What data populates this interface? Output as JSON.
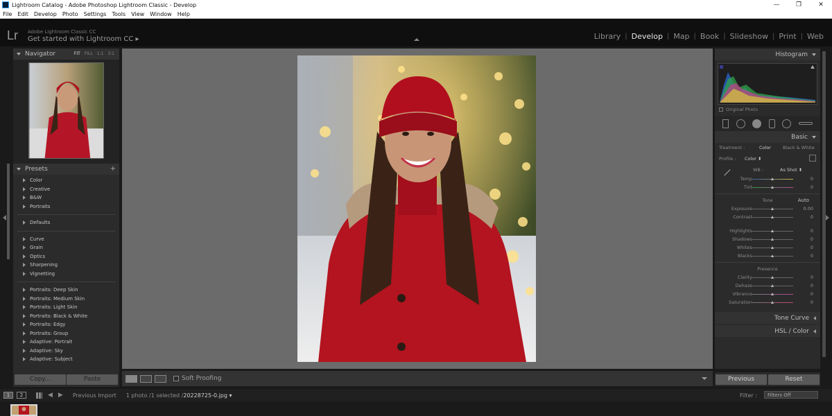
{
  "window": {
    "title": "Lightroom Catalog - Adobe Photoshop Lightroom Classic - Develop",
    "controls": [
      "—",
      "❐",
      "✕"
    ]
  },
  "menu": [
    "File",
    "Edit",
    "Develop",
    "Photo",
    "Settings",
    "Tools",
    "View",
    "Window",
    "Help"
  ],
  "identity": {
    "logo": "Lr",
    "product": "Adobe Lightroom Classic CC",
    "tagline": "Get started with Lightroom CC ▸"
  },
  "modules": {
    "items": [
      "Library",
      "Develop",
      "Map",
      "Book",
      "Slideshow",
      "Print",
      "Web"
    ],
    "active": "Develop"
  },
  "navigator": {
    "title": "Navigator",
    "zoom": [
      "FIT",
      "FILL",
      "1:1",
      "3:1"
    ],
    "zoom_selected": "FIT"
  },
  "presets": {
    "title": "Presets",
    "groups": [
      [
        "Color",
        "Creative",
        "B&W",
        "Portraits"
      ],
      [
        "Defaults"
      ],
      [
        "Curve",
        "Grain",
        "Optics",
        "Sharpening",
        "Vignetting"
      ],
      [
        "Portraits: Deep Skin",
        "Portraits: Medium Skin",
        "Portraits: Light Skin",
        "Portraits: Black & White",
        "Portraits: Edgy",
        "Portraits: Group",
        "Adaptive: Portrait",
        "Adaptive: Sky",
        "Adaptive: Subject"
      ]
    ]
  },
  "left_buttons": {
    "copy": "Copy...",
    "paste": "Paste"
  },
  "toolbar": {
    "soft_proofing": "Soft Proofing"
  },
  "right": {
    "histogram_title": "Histogram",
    "original_photo": "Original Photo",
    "basic_title": "Basic",
    "treatment_label": "Treatment :",
    "treatment_color": "Color",
    "treatment_bw": "Black & White",
    "profile_label": "Profile :",
    "profile_value": "Color ⬍",
    "wb_label": "WB :",
    "wb_value": "As Shot ⬍",
    "wb_sliders": [
      {
        "label": "Temp",
        "value": "0"
      },
      {
        "label": "Tint",
        "value": "0"
      }
    ],
    "tone_label": "Tone",
    "auto_label": "Auto",
    "tone_sliders_a": [
      {
        "label": "Exposure",
        "value": "0.00"
      },
      {
        "label": "Contrast",
        "value": "0"
      }
    ],
    "tone_sliders_b": [
      {
        "label": "Highlights",
        "value": "0"
      },
      {
        "label": "Shadows",
        "value": "0"
      },
      {
        "label": "Whites",
        "value": "0"
      },
      {
        "label": "Blacks",
        "value": "0"
      }
    ],
    "presence_label": "Presence",
    "presence_sliders": [
      {
        "label": "Clarity",
        "value": "0"
      },
      {
        "label": "Dehaze",
        "value": "0"
      },
      {
        "label": "Vibrance",
        "value": "0"
      },
      {
        "label": "Saturation",
        "value": "0"
      }
    ],
    "tone_curve_title": "Tone Curve",
    "hsl_title": "HSL / Color",
    "previous": "Previous",
    "reset": "Reset"
  },
  "filmstrip_bar": {
    "screen1": "1",
    "screen2": "2",
    "source": "Previous Import",
    "count": "1 photo /1 selected /",
    "filename": "20228725-0.jpg ▾",
    "filter_label": "Filter :",
    "filter_value": "Filters Off"
  }
}
